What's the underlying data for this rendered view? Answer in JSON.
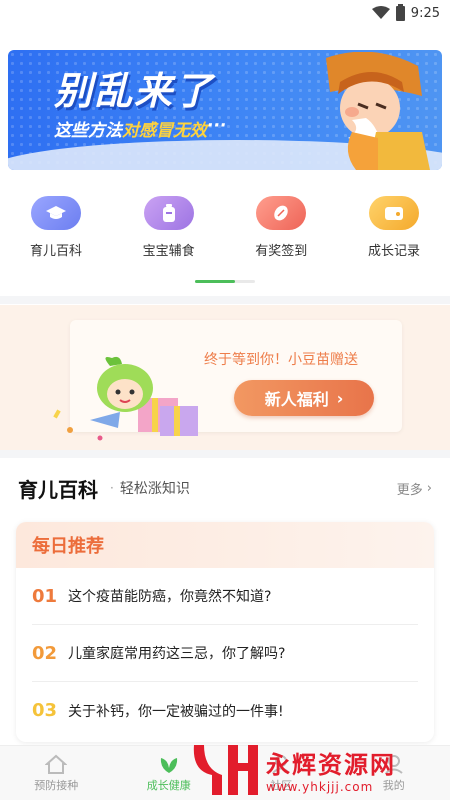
{
  "status": {
    "time": "9:25"
  },
  "banner": {
    "title": "别乱来了",
    "subtitle_prefix": "这些方法",
    "subtitle_highlight": "对感冒无效",
    "subtitle_suffix": "···"
  },
  "categories": [
    {
      "label": "育儿百科",
      "icon": "graduation-cap-icon",
      "color": "#7f8cf2"
    },
    {
      "label": "宝宝辅食",
      "icon": "baby-bottle-icon",
      "color": "#b48ae9"
    },
    {
      "label": "有奖签到",
      "icon": "bean-icon",
      "color": "#f07a6a"
    },
    {
      "label": "成长记录",
      "icon": "wallet-icon",
      "color": "#f7b63a"
    }
  ],
  "promo": {
    "text": "终于等到你！小豆苗赠送",
    "button": "新人福利",
    "button_arrow": "›"
  },
  "section": {
    "title": "育儿百科",
    "dot": "·",
    "subtitle": "轻松涨知识",
    "more": "更多",
    "more_arrow": "›"
  },
  "daily": {
    "title": "每日推荐",
    "items": [
      {
        "num": "01",
        "text": "这个疫苗能防癌，你竟然不知道?",
        "color": "#ee7a3c"
      },
      {
        "num": "02",
        "text": "儿童家庭常用药这三忌，你了解吗?",
        "color": "#f29a3a"
      },
      {
        "num": "03",
        "text": "关于补钙，你一定被骗过的一件事!",
        "color": "#f5c33a"
      }
    ]
  },
  "tabs": [
    {
      "label": "预防接种",
      "icon": "home-icon",
      "active": false
    },
    {
      "label": "成长健康",
      "icon": "leaf-icon",
      "active": true
    },
    {
      "label": "社区",
      "icon": "community-icon",
      "active": false
    },
    {
      "label": "我的",
      "icon": "profile-icon",
      "active": false
    }
  ],
  "watermark": {
    "name": "永辉资源网",
    "url": "www.yhkjjj.com"
  }
}
